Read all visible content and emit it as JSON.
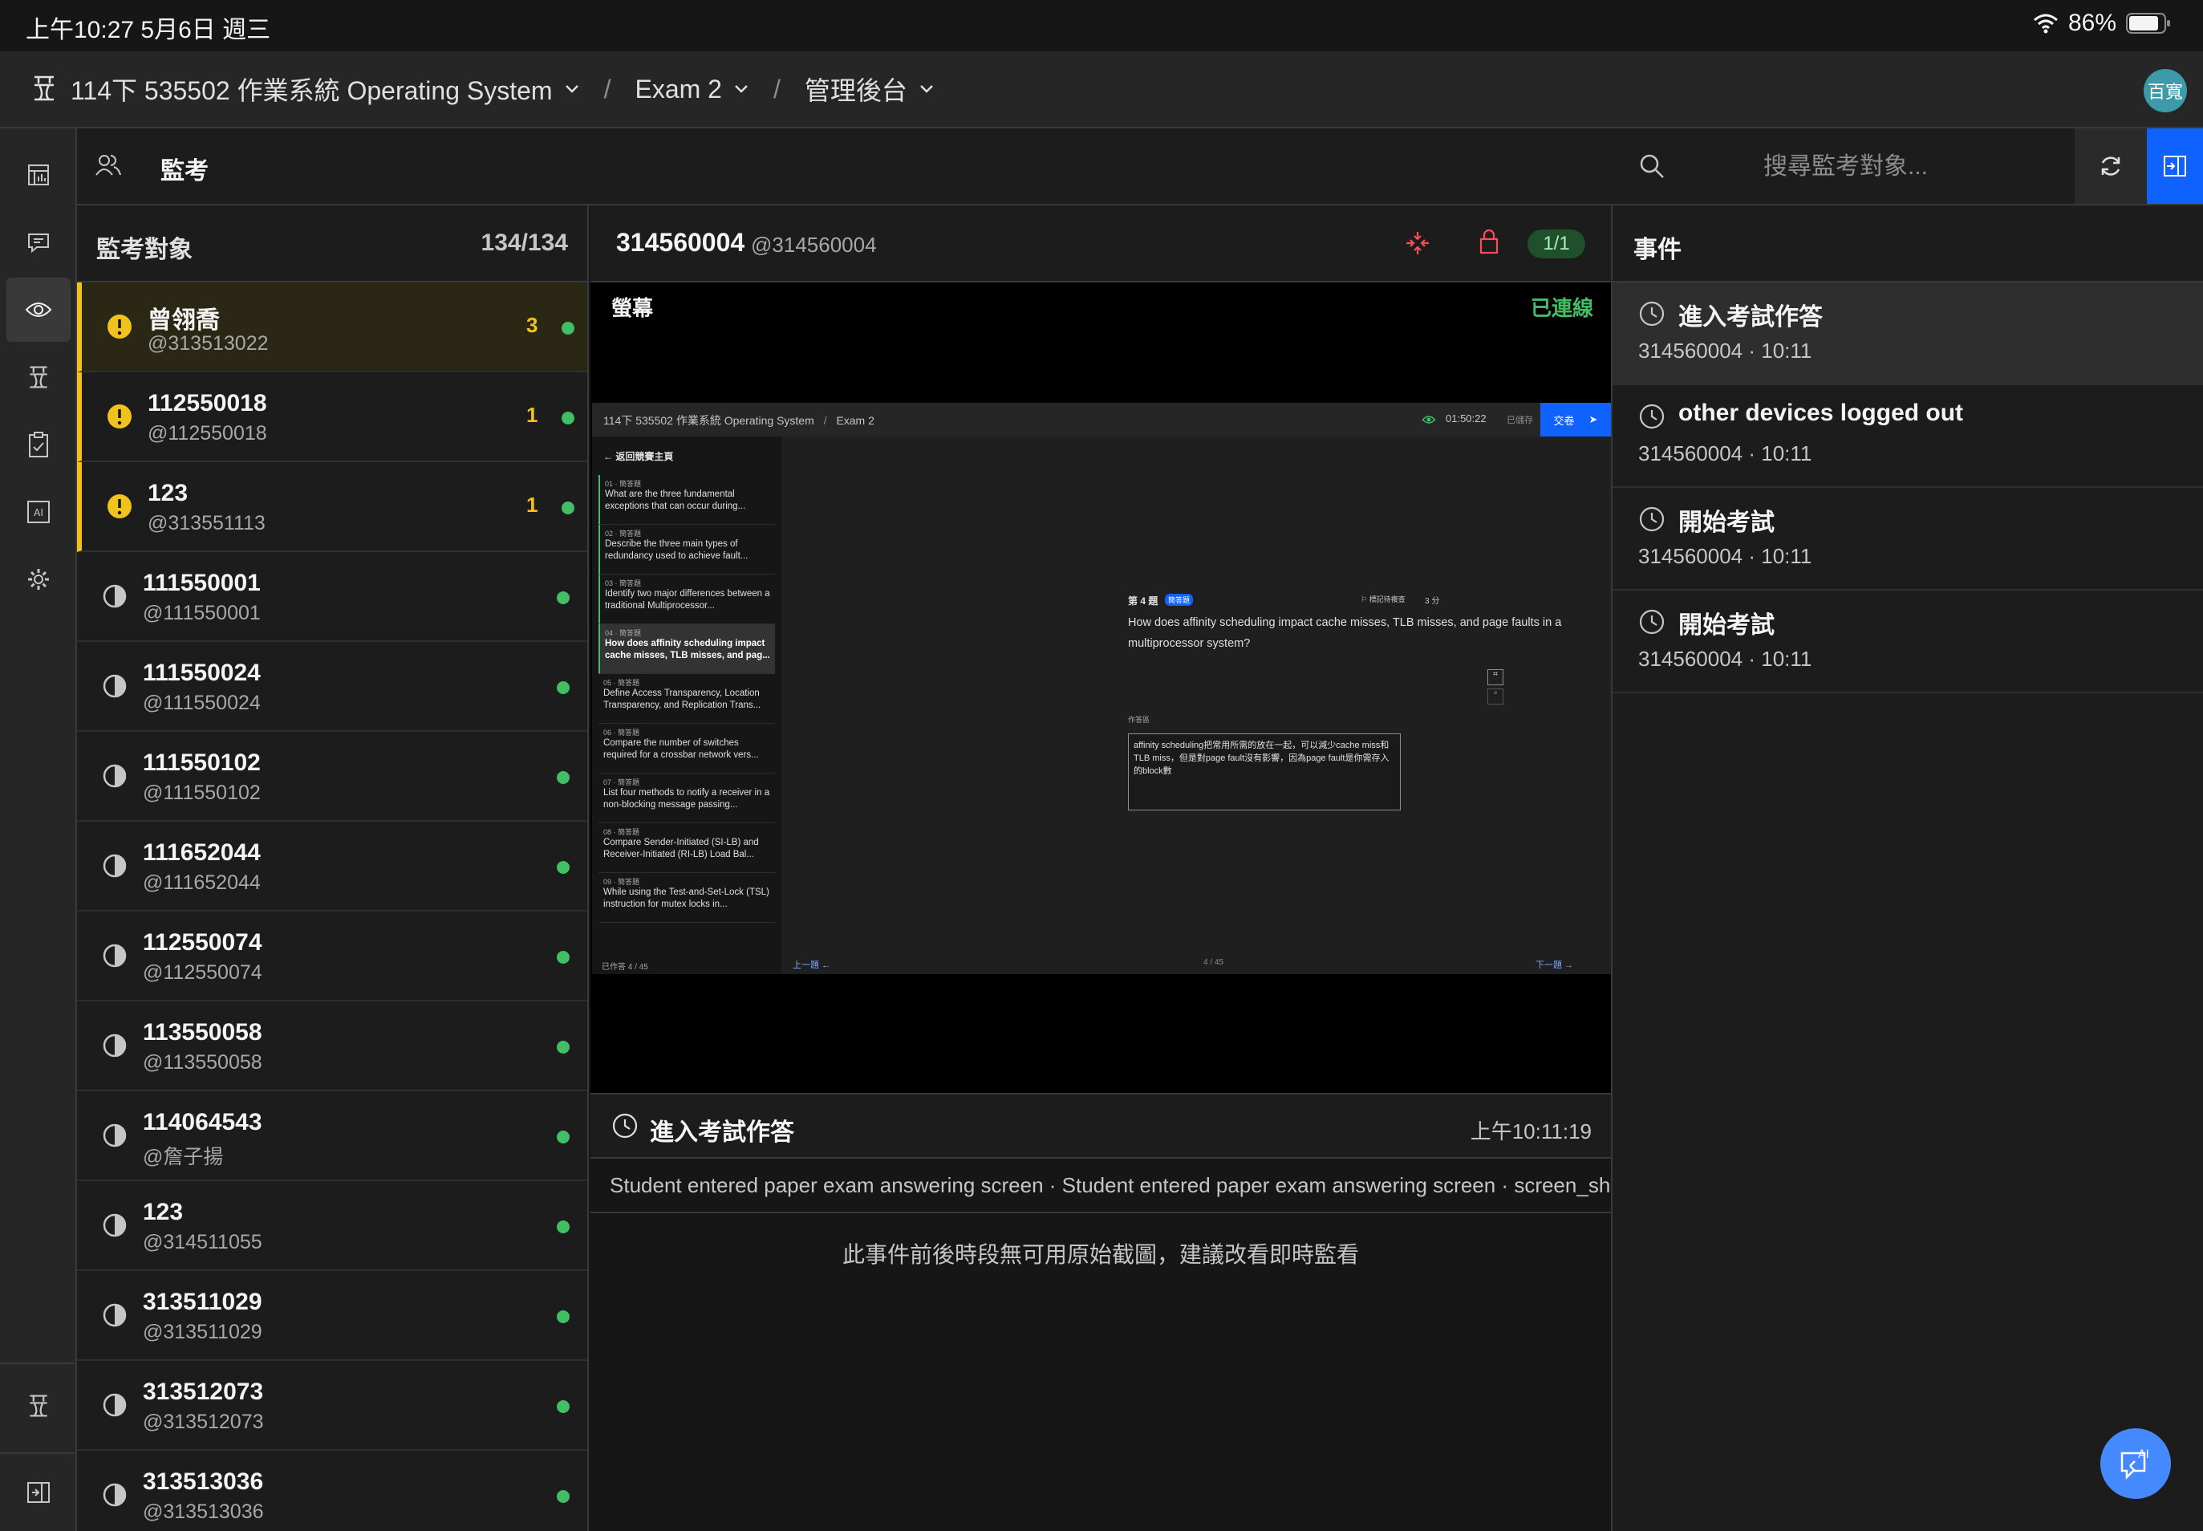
{
  "status_bar": {
    "time": "上午10:27  5月6日 週三",
    "battery": "86%"
  },
  "header": {
    "breadcrumbs": [
      {
        "label": "114下 535502 作業系統 Operating System"
      },
      {
        "label": "Exam 2"
      },
      {
        "label": "管理後台"
      }
    ],
    "user_avatar": "百寬"
  },
  "toolbar": {
    "title": "監考",
    "search_placeholder": "搜尋監考對象..."
  },
  "roster": {
    "title": "監考對象",
    "count": "134/134",
    "students": [
      {
        "name": "曾翎喬",
        "handle": "@313513022",
        "alerts": "3",
        "state": "warn"
      },
      {
        "name": "112550018",
        "handle": "@112550018",
        "alerts": "1",
        "state": "warn"
      },
      {
        "name": "123",
        "handle": "@313551113",
        "alerts": "1",
        "state": "warn"
      },
      {
        "name": "111550001",
        "handle": "@111550001",
        "alerts": "",
        "state": "progress"
      },
      {
        "name": "111550024",
        "handle": "@111550024",
        "alerts": "",
        "state": "progress"
      },
      {
        "name": "111550102",
        "handle": "@111550102",
        "alerts": "",
        "state": "progress"
      },
      {
        "name": "111652044",
        "handle": "@111652044",
        "alerts": "",
        "state": "progress"
      },
      {
        "name": "112550074",
        "handle": "@112550074",
        "alerts": "",
        "state": "progress"
      },
      {
        "name": "113550058",
        "handle": "@113550058",
        "alerts": "",
        "state": "progress"
      },
      {
        "name": "114064543",
        "handle": "@詹子揚",
        "alerts": "",
        "state": "progress"
      },
      {
        "name": "123",
        "handle": "@314511055",
        "alerts": "",
        "state": "progress"
      },
      {
        "name": "313511029",
        "handle": "@313511029",
        "alerts": "",
        "state": "progress"
      },
      {
        "name": "313512073",
        "handle": "@313512073",
        "alerts": "",
        "state": "progress"
      },
      {
        "name": "313513036",
        "handle": "@313513036",
        "alerts": "",
        "state": "progress"
      }
    ]
  },
  "student_view": {
    "id": "314560004",
    "handle": "@314560004",
    "page": "1/1",
    "screen_label": "螢幕",
    "connection": "已連線",
    "mini": {
      "course": "114下 535502 作業系統 Operating System",
      "exam": "Exam 2",
      "timer": "01:50:22",
      "saved": "已儲存",
      "submit": "交卷",
      "back": "返回競賽主頁",
      "questions": [
        {
          "num": "01 · 簡答題",
          "text": "What are the three fundamental exceptions that can occur during..."
        },
        {
          "num": "02 · 簡答題",
          "text": "Describe the three main types of redundancy used to achieve fault..."
        },
        {
          "num": "03 · 簡答題",
          "text": "Identify two major differences between a traditional Multiprocessor..."
        },
        {
          "num": "04 · 簡答題",
          "text": "How does affinity scheduling impact cache misses, TLB misses, and pag..."
        },
        {
          "num": "05 · 簡答題",
          "text": "Define Access Transparency, Location Transparency, and Replication Trans..."
        },
        {
          "num": "06 · 簡答題",
          "text": "Compare the number of switches required for a crossbar network vers..."
        },
        {
          "num": "07 · 簡答題",
          "text": "List four methods to notify a receiver in a non-blocking message passing..."
        },
        {
          "num": "08 · 簡答題",
          "text": "Compare Sender-Initiated (SI-LB) and Receiver-Initiated (RI-LB) Load Bal..."
        },
        {
          "num": "09 · 簡答題",
          "text": "While using the Test-and-Set-Lock (TSL) instruction for mutex locks in..."
        }
      ],
      "progress": "已作答 4 / 45",
      "q_title": "第 4 題",
      "q_type": "簡答題",
      "bookmark": "標記待複查",
      "points": "3 分",
      "question_line1": "How does affinity scheduling impact cache misses, TLB misses, and page faults in a",
      "question_line2": "multiprocessor system?",
      "answer_label": "作答區",
      "answer": "affinity scheduling把常用所需的放在一起，可以減少cache miss和TLB miss，但是對page fault沒有影響，因為page fault是你需存入的block數",
      "prev": "上一題",
      "page_indicator": "4 / 45",
      "next": "下一題"
    }
  },
  "event_detail": {
    "title": "進入考試作答",
    "time": "上午10:11:19",
    "description": "Student entered paper exam answering screen · Student entered paper exam answering screen · screen_share",
    "note": "此事件前後時段無可用原始截圖，建議改看即時監看"
  },
  "events": {
    "title": "事件",
    "items": [
      {
        "title": "進入考試作答",
        "sub": "314560004 · 10:11"
      },
      {
        "title": "other devices logged out",
        "sub": "314560004 · 10:11"
      },
      {
        "title": "開始考試",
        "sub": "314560004 · 10:11"
      },
      {
        "title": "開始考試",
        "sub": "314560004 · 10:11"
      }
    ]
  },
  "colors": {
    "accent": "#0f62fe",
    "warn": "#f1c21b",
    "online": "#42be65",
    "alert_red": "#fa4d56"
  }
}
